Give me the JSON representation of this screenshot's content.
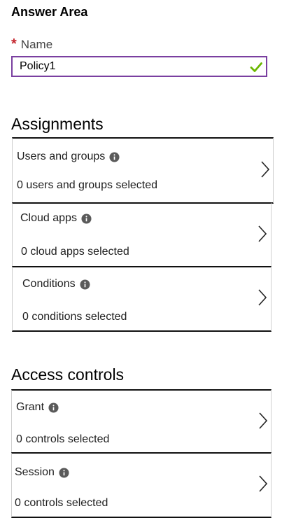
{
  "header": {
    "title": "Answer Area"
  },
  "name_field": {
    "required_mark": "*",
    "label": "Name",
    "value": "Policy1"
  },
  "assignments": {
    "heading": "Assignments",
    "items": [
      {
        "title": "Users and groups",
        "subtitle": "0 users and groups selected"
      },
      {
        "title": "Cloud apps",
        "subtitle": "0 cloud apps selected"
      },
      {
        "title": "Conditions",
        "subtitle": "0 conditions selected"
      }
    ]
  },
  "access_controls": {
    "heading": "Access controls",
    "items": [
      {
        "title": "Grant",
        "subtitle": "0 controls selected"
      },
      {
        "title": "Session",
        "subtitle": "0 controls selected"
      }
    ]
  },
  "icons": {
    "valid": "checkmark-icon",
    "info": "info-icon",
    "expand": "chevron-right-icon"
  },
  "colors": {
    "required": "#c4262e",
    "input_border": "#7a3fa0",
    "valid": "#6bb700",
    "info": "#5a5a5a"
  }
}
